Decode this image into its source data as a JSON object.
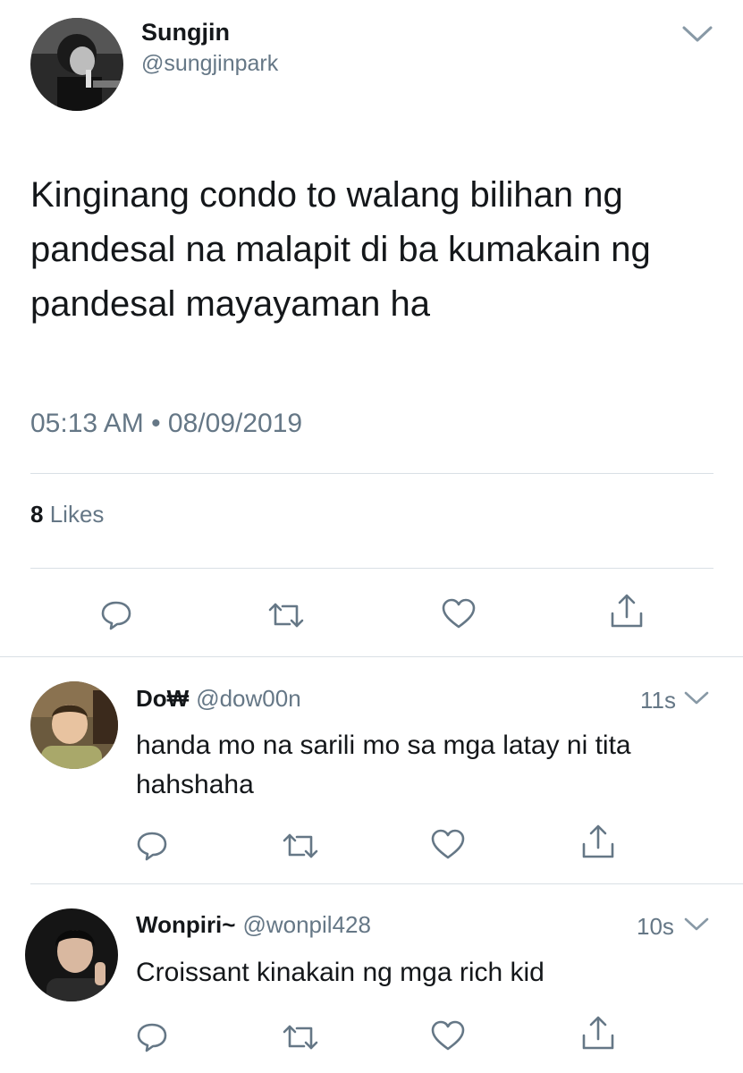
{
  "main_tweet": {
    "name": "Sungjin",
    "handle": "@sungjinpark",
    "text": "Kinginang condo to walang bilihan ng pandesal na malapit di ba kumakain ng pandesal mayayaman ha",
    "timestamp": "05:13 AM • 08/09/2019",
    "likes_count": "8",
    "likes_label": "Likes"
  },
  "replies": [
    {
      "name": "Do₩",
      "handle": "@dow00n",
      "time": "11s",
      "text": "handa mo na sarili mo sa mga latay ni tita hahshaha"
    },
    {
      "name": "Wonpiri~",
      "handle": "@wonpil428",
      "time": "10s",
      "text": "Croissant kinakain ng mga rich kid"
    }
  ],
  "icons": {
    "reply": "reply-icon",
    "retweet": "retweet-icon",
    "like": "heart-icon",
    "share": "share-icon",
    "more": "chevron-down-icon"
  },
  "colors": {
    "text": "#14171a",
    "secondary": "#657786",
    "divider": "#d9e0e5"
  }
}
